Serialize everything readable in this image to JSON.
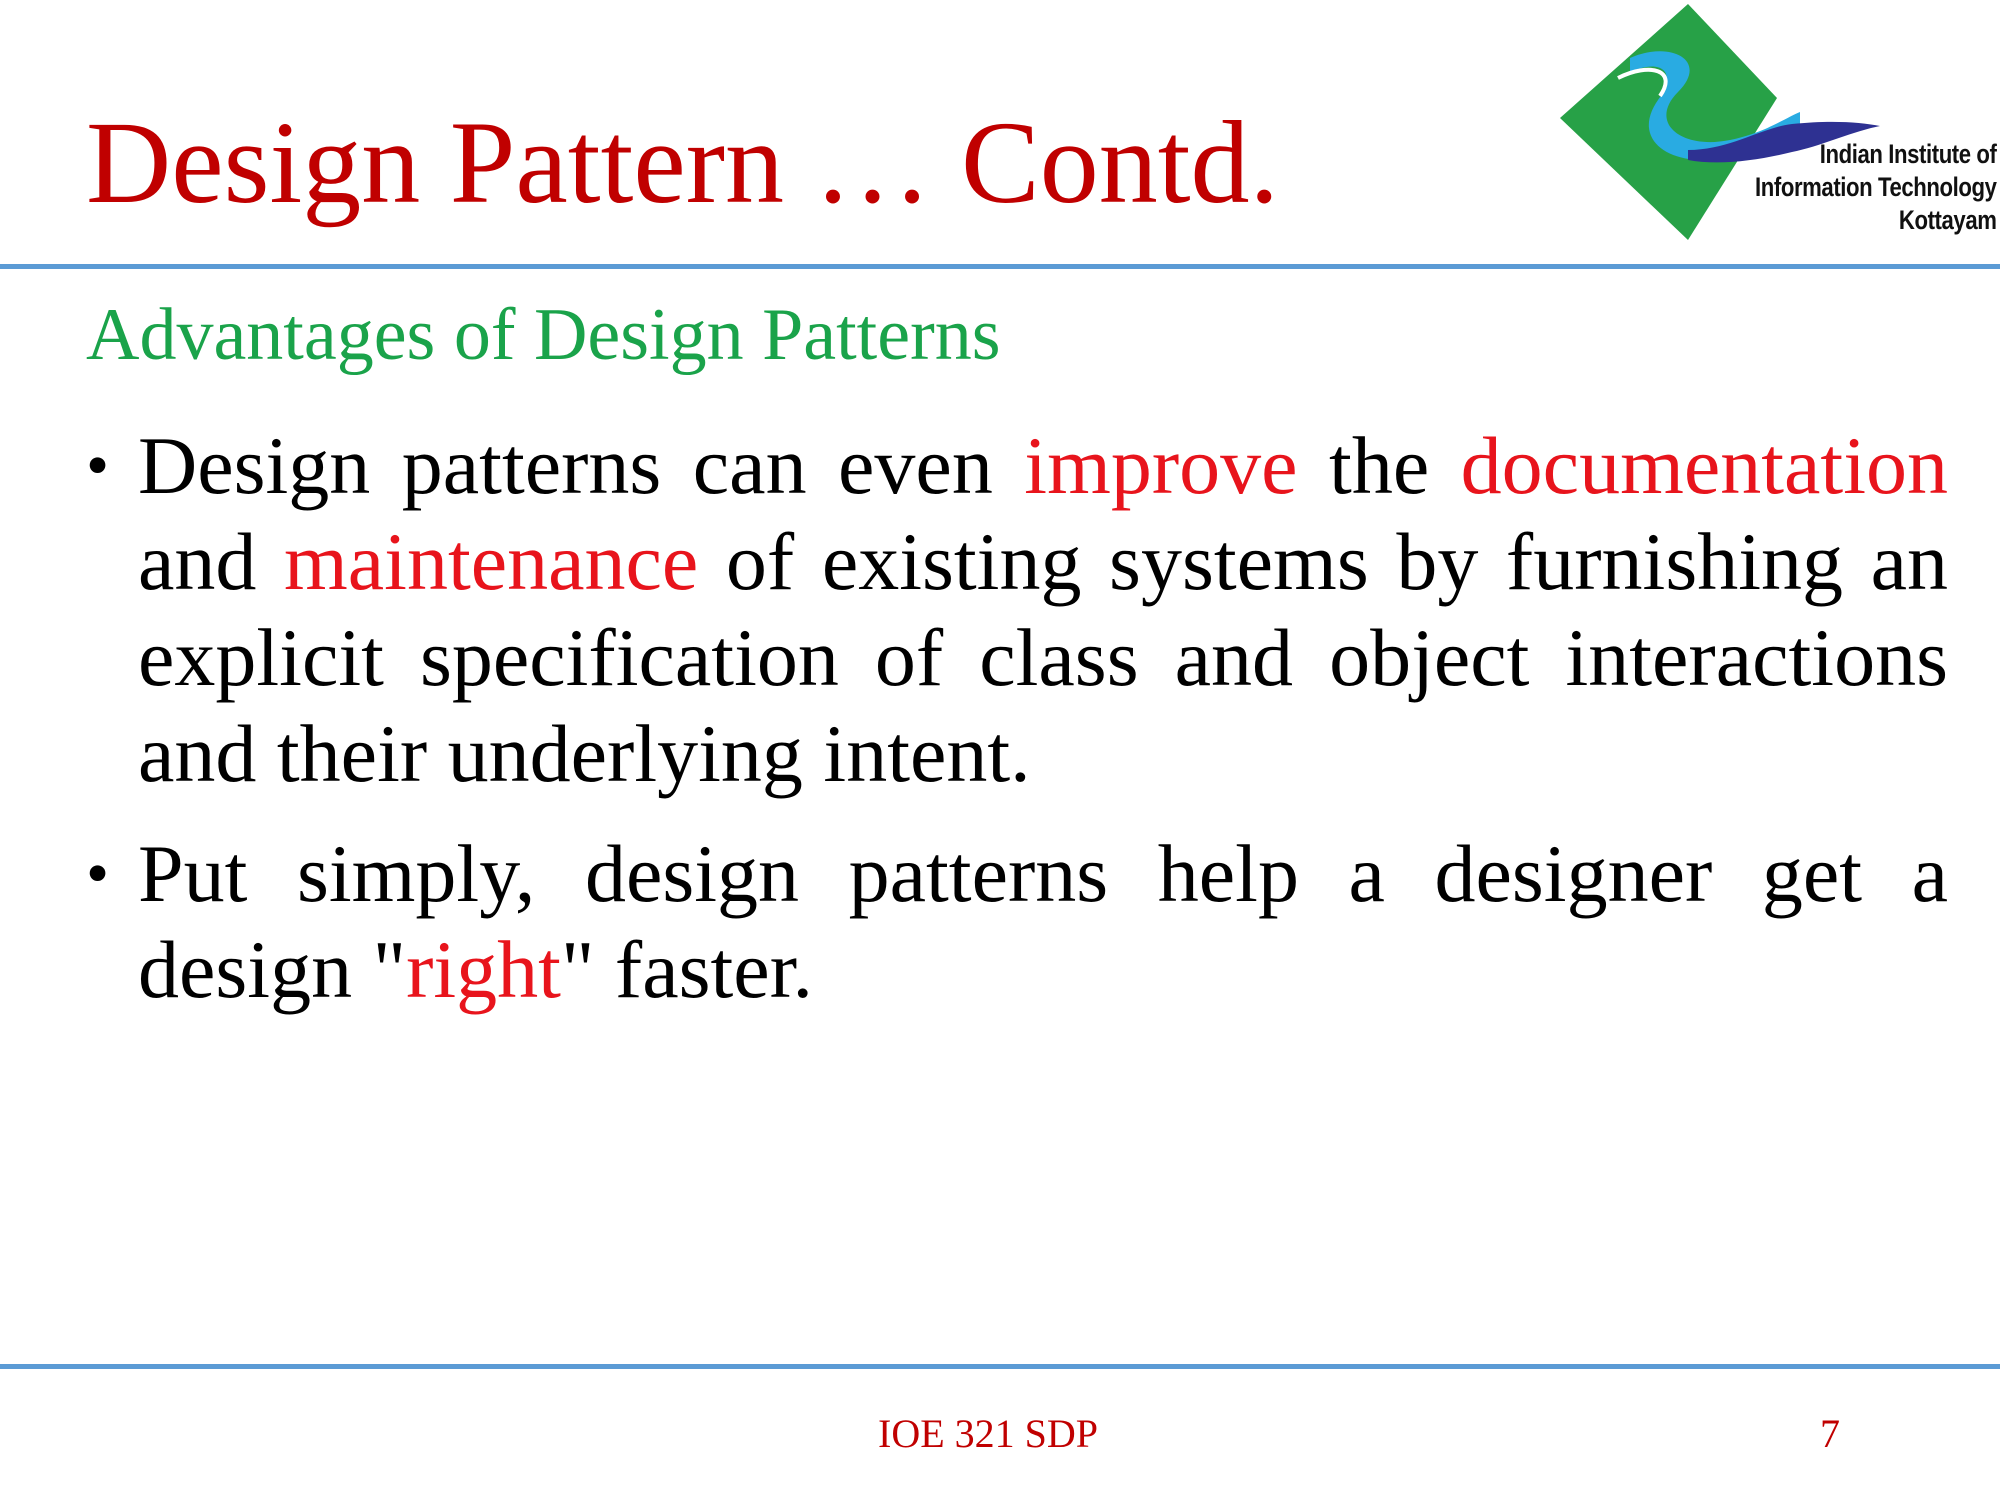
{
  "slide": {
    "title": "Design Pattern … Contd.",
    "subheading": "Advantages of  Design Patterns"
  },
  "logo": {
    "line1": "Indian Institute of",
    "line2": "Information Technology",
    "line3": "Kottayam",
    "colors": {
      "diamond": "#27a147",
      "wave_cyan": "#29abe2",
      "wave_navy": "#2e3192"
    }
  },
  "bullets": [
    {
      "bullet_glyph": "•",
      "p1": "Design patterns can even ",
      "e1": "improve",
      "p2": " the ",
      "e2": "documentation",
      "p3": " and ",
      "e3": "maintenance",
      "p4": " of existing systems by furnishing an explicit specification of class and object interactions and their underlying intent."
    },
    {
      "bullet_glyph": "•",
      "p1": "Put simply, design patterns help a designer get a design \"",
      "e1": "right",
      "p2": "\" faster."
    }
  ],
  "footer": {
    "course": "IOE 321 SDP",
    "page_number": "7"
  },
  "colors": {
    "title": "#c00000",
    "subheading": "#1aa34a",
    "body_text": "#000000",
    "emphasis": "#e8141c",
    "rule": "#5b9bd5",
    "footer": "#c00000"
  }
}
